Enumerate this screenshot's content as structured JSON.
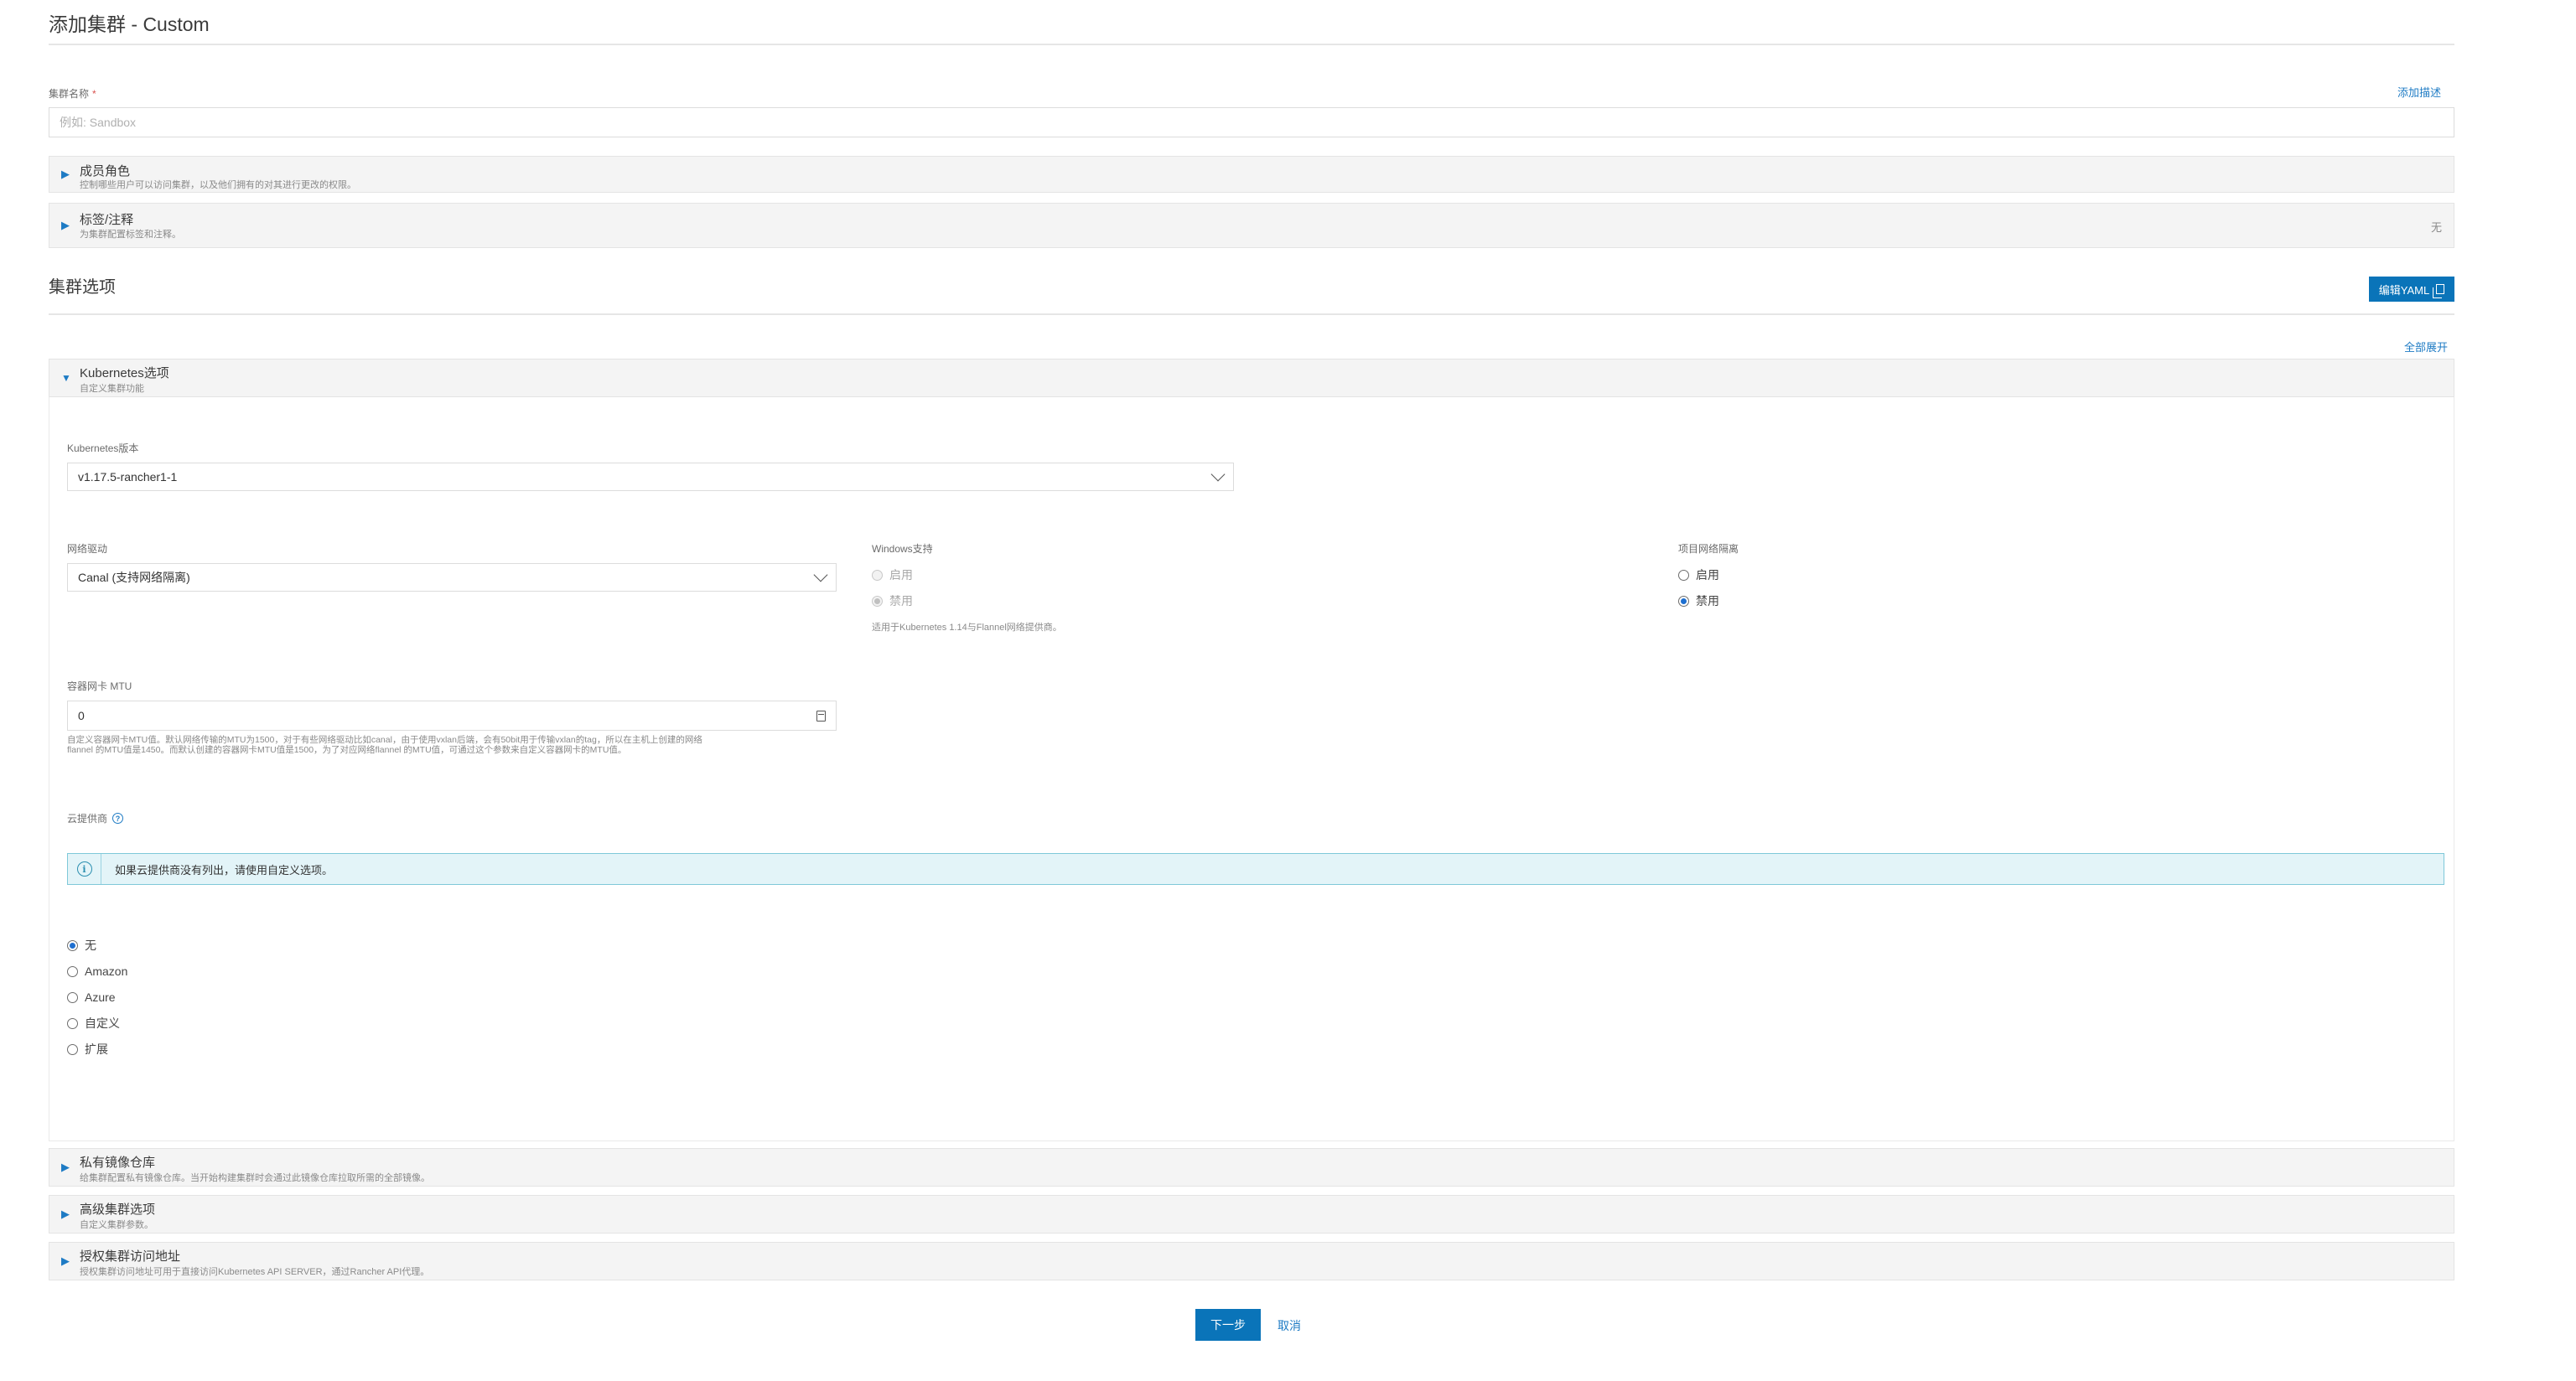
{
  "page": {
    "title": "添加集群 - Custom"
  },
  "cluster_name": {
    "label": "集群名称",
    "required_mark": "*",
    "placeholder": "例如: Sandbox",
    "add_description_link": "添加描述"
  },
  "member_roles": {
    "title": "成员角色",
    "subtitle": "控制哪些用户可以访问集群，以及他们拥有的对其进行更改的权限。"
  },
  "labels_annotations": {
    "title": "标签/注释",
    "subtitle": "为集群配置标签和注释。",
    "status": "无"
  },
  "cluster_options": {
    "title": "集群选项",
    "edit_yaml_button": "编辑YAML",
    "expand_all_link": "全部展开"
  },
  "kubernetes_options": {
    "title": "Kubernetes选项",
    "subtitle": "自定义集群功能",
    "version": {
      "label": "Kubernetes版本",
      "value": "v1.17.5-rancher1-1"
    },
    "network_provider": {
      "label": "网络驱动",
      "value": "Canal (支持网络隔离)"
    },
    "windows_support": {
      "label": "Windows支持",
      "options": [
        "启用",
        "禁用"
      ],
      "selected": "禁用",
      "disabled": true,
      "hint": "适用于Kubernetes 1.14与Flannel网络提供商。"
    },
    "project_network_isolation": {
      "label": "项目网络隔离",
      "options": [
        "启用",
        "禁用"
      ],
      "selected": "禁用"
    },
    "mtu": {
      "label": "容器网卡 MTU",
      "value": "0",
      "hint_line1": "自定义容器网卡MTU值。默认网络传输的MTU为1500，对于有些网络驱动比如canal，由于使用vxlan后端，会有50bit用于传输vxlan的tag，所以在主机上创建的网络",
      "hint_line2": "flannel 的MTU值是1450。而默认创建的容器网卡MTU值是1500，为了对应网络flannel 的MTU值，可通过这个参数来自定义容器网卡的MTU值。"
    },
    "cloud_provider": {
      "label": "云提供商",
      "info_banner": "如果云提供商没有列出，请使用自定义选项。",
      "options": [
        "无",
        "Amazon",
        "Azure",
        "自定义",
        "扩展"
      ],
      "selected": "无"
    }
  },
  "private_registry": {
    "title": "私有镜像仓库",
    "subtitle": "给集群配置私有镜像仓库。当开始构建集群时会通过此镜像仓库拉取所需的全部镜像。"
  },
  "advanced_options": {
    "title": "高级集群选项",
    "subtitle": "自定义集群参数。"
  },
  "authorized_endpoint": {
    "title": "授权集群访问地址",
    "subtitle": "授权集群访问地址可用于直接访问Kubernetes API SERVER，通过Rancher API代理。"
  },
  "footer": {
    "next_button": "下一步",
    "cancel_link": "取消"
  },
  "colors": {
    "primary": "#0a74b9",
    "link": "#1e7bc4",
    "info_bg": "#e3f4f8",
    "radio_selected": "#1e6fd0"
  }
}
